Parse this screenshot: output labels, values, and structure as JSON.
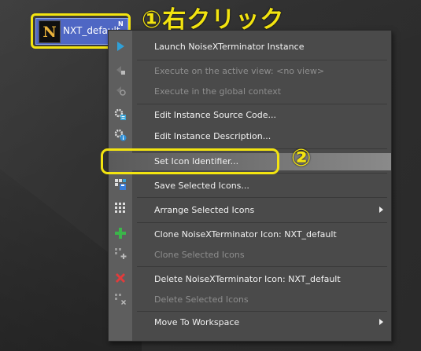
{
  "desktop_icon": {
    "logo_letter": "N",
    "label": "NXT_default",
    "badge": "N"
  },
  "annotations": {
    "step1": "①右クリック",
    "step2": "②"
  },
  "menu": {
    "items": [
      {
        "label": "Launch NoiseXTerminator Instance",
        "enabled": true
      },
      {
        "label": "Execute on the active view: <no view>",
        "enabled": false
      },
      {
        "label": "Execute in the global context",
        "enabled": false
      },
      {
        "label": "Edit Instance Source Code...",
        "enabled": true
      },
      {
        "label": "Edit Instance Description...",
        "enabled": true
      },
      {
        "label": "Set Icon Identifier...",
        "enabled": true,
        "selected": true
      },
      {
        "label": "Save Selected Icons...",
        "enabled": true
      },
      {
        "label": "Arrange Selected Icons",
        "enabled": true,
        "submenu": true
      },
      {
        "label": "Clone NoiseXTerminator Icon: NXT_default",
        "enabled": true
      },
      {
        "label": "Clone Selected Icons",
        "enabled": false
      },
      {
        "label": "Delete NoiseXTerminator Icon: NXT_default",
        "enabled": true
      },
      {
        "label": "Delete Selected Icons",
        "enabled": false
      },
      {
        "label": "Move To Workspace",
        "enabled": true,
        "submenu": true
      }
    ]
  },
  "colors": {
    "highlight": "#f3e410",
    "tile": "#4f67c4",
    "clone_icon": "#3bb54a",
    "delete_icon": "#e23b3b"
  }
}
